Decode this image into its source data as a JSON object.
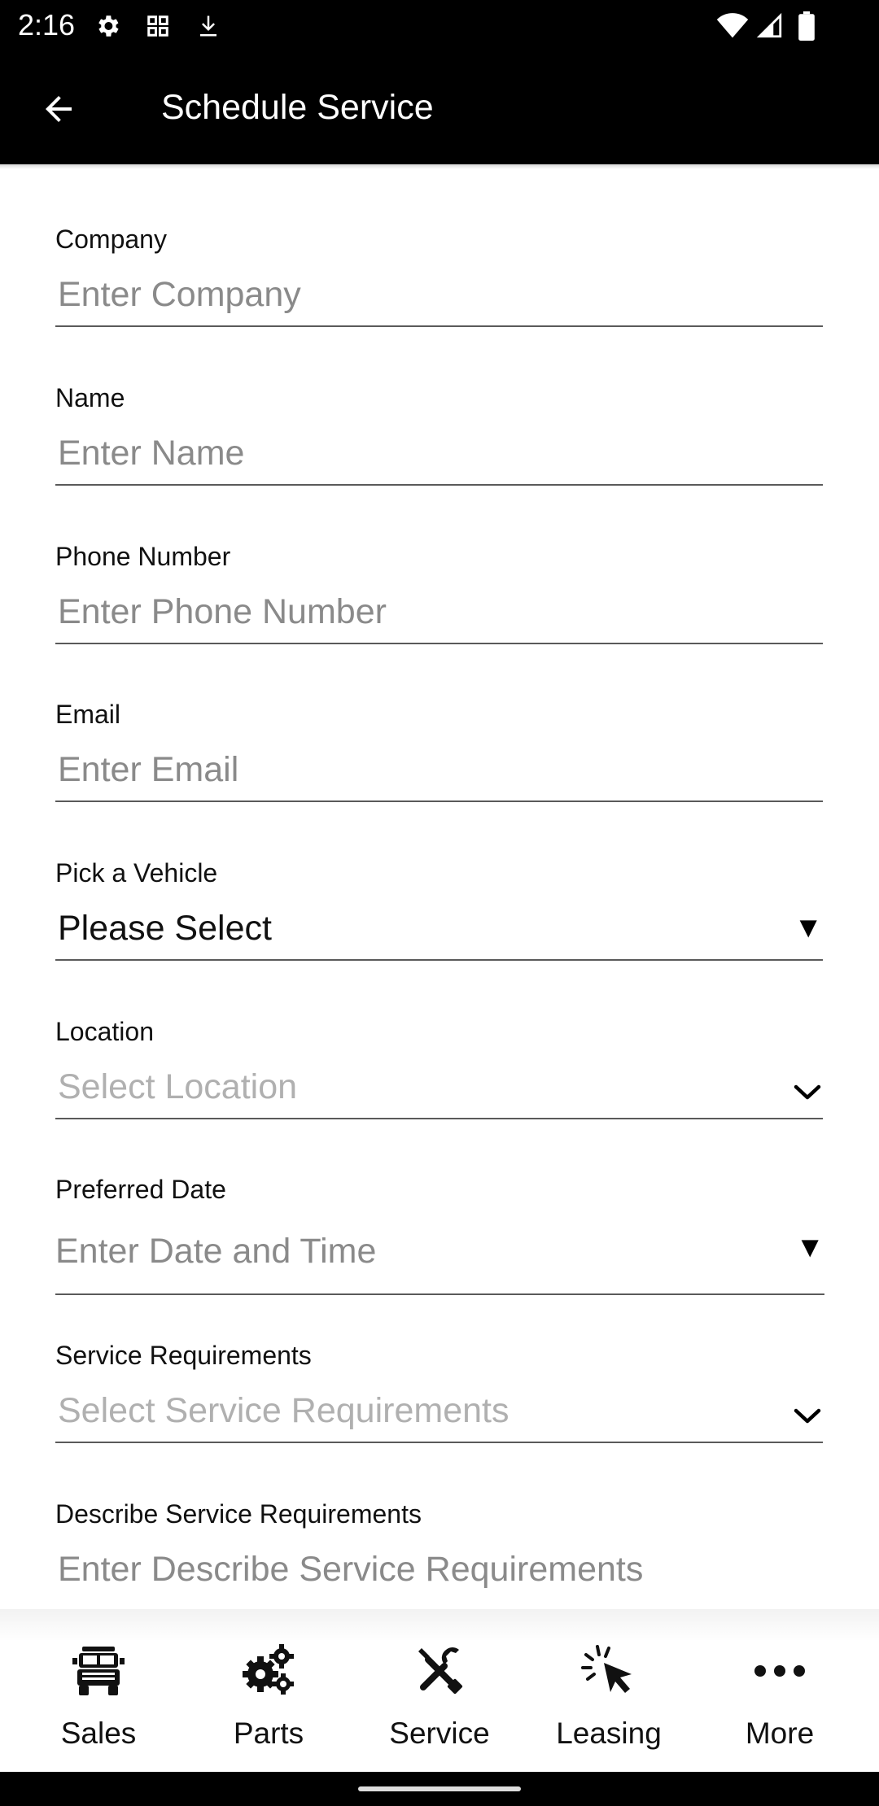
{
  "status_bar": {
    "time": "2:16",
    "left_icons": [
      "gear-icon",
      "grid-icon",
      "download-icon"
    ],
    "right_icons": [
      "wifi-icon",
      "signal-icon",
      "battery-icon"
    ]
  },
  "app_bar": {
    "title": "Schedule Service",
    "back_icon": "arrow-left-icon"
  },
  "form": {
    "company": {
      "label": "Company",
      "placeholder": "Enter Company"
    },
    "name": {
      "label": "Name",
      "placeholder": "Enter Name"
    },
    "phone": {
      "label": "Phone Number",
      "placeholder": "Enter Phone Number"
    },
    "email": {
      "label": "Email",
      "placeholder": "Enter Email"
    },
    "vehicle": {
      "label": "Pick a Vehicle",
      "value": "Please Select",
      "indicator": "▼"
    },
    "location": {
      "label": "Location",
      "placeholder": "Select Location"
    },
    "preferred_date": {
      "label": "Preferred Date",
      "placeholder": "Enter Date and Time",
      "indicator": "▼"
    },
    "service_requirements": {
      "label": "Service Requirements",
      "placeholder": "Select Service Requirements"
    },
    "describe": {
      "label": "Describe Service Requirements",
      "placeholder": "Enter Describe Service Requirements"
    }
  },
  "bottom_nav": {
    "items": [
      {
        "label": "Sales",
        "icon": "truck-icon"
      },
      {
        "label": "Parts",
        "icon": "gears-icon"
      },
      {
        "label": "Service",
        "icon": "tools-icon"
      },
      {
        "label": "Leasing",
        "icon": "cursor-click-icon"
      },
      {
        "label": "More",
        "icon": "more-dots-icon"
      }
    ]
  }
}
